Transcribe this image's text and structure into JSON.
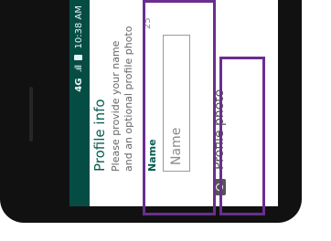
{
  "status_bar": {
    "network": "4G",
    "signal": ".ıll",
    "time": "10:38 AM"
  },
  "profile": {
    "title": "Profile info",
    "description": "Please provide your name and an optional profile photo"
  },
  "name_field": {
    "label": "Name",
    "placeholder": "Name",
    "value": "",
    "char_remaining": "25"
  },
  "photo": {
    "label": "Profile photo",
    "icon": "camera-icon"
  },
  "colors": {
    "header": "#075e54",
    "highlight": "#6b2e8f"
  }
}
